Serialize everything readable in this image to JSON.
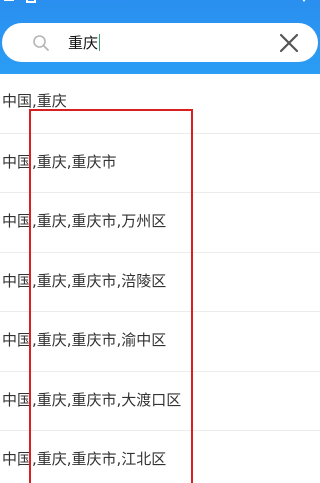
{
  "search": {
    "query": "重庆",
    "search_icon": "search-icon",
    "clear_icon": "close-icon"
  },
  "topbar": {
    "color": "#2a95f2",
    "icons": [
      "back-icon",
      "image-icon",
      "chevron-down-icon"
    ]
  },
  "results": [
    {
      "label": "中国,重庆"
    },
    {
      "label": "中国,重庆,重庆市"
    },
    {
      "label": "中国,重庆,重庆市,万州区"
    },
    {
      "label": "中国,重庆,重庆市,涪陵区"
    },
    {
      "label": "中国,重庆,重庆市,渝中区"
    },
    {
      "label": "中国,重庆,重庆市,大渡口区"
    },
    {
      "label": "中国,重庆,重庆市,江北区"
    }
  ],
  "annotation": {
    "color": "#d91f1f"
  }
}
